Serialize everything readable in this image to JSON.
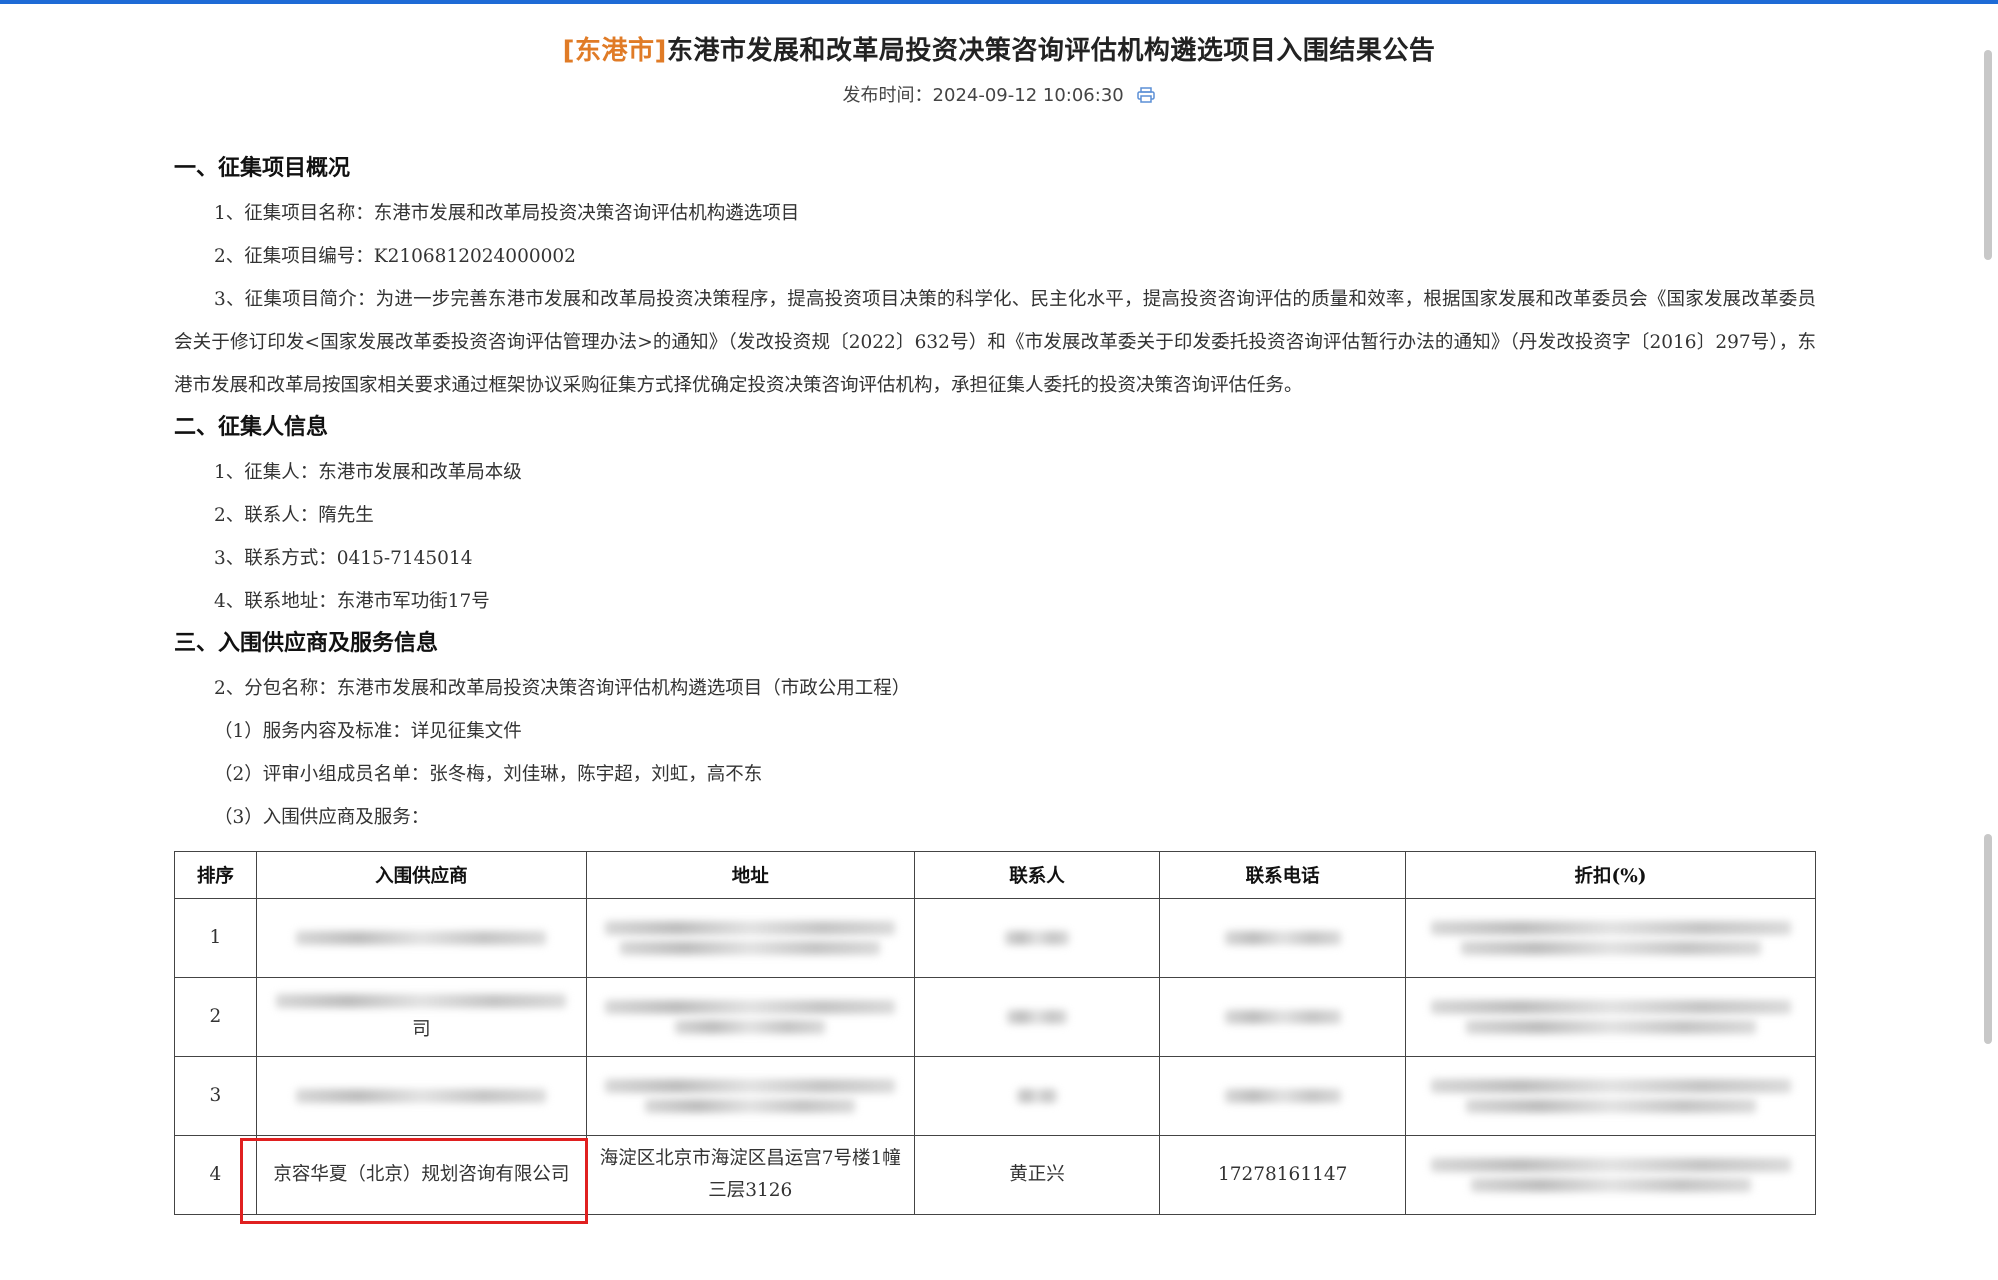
{
  "header": {
    "region_tag": "[东港市]",
    "title": "东港市发展和改革局投资决策咨询评估机构遴选项目入围结果公告",
    "publish_label": "发布时间：",
    "publish_time": "2024-09-12 10:06:30"
  },
  "section1": {
    "heading": "一、征集项目概况",
    "item1": "1、征集项目名称：东港市发展和改革局投资决策咨询评估机构遴选项目",
    "item2": "2、征集项目编号：K2106812024000002",
    "item3": "3、征集项目简介：为进一步完善东港市发展和改革局投资决策程序，提高投资项目决策的科学化、民主化水平，提高投资咨询评估的质量和效率，根据国家发展和改革委员会《国家发展改革委员会关于修订印发<国家发展改革委投资咨询评估管理办法>的通知》（发改投资规〔2022〕632号）和《市发展改革委关于印发委托投资咨询评估暂行办法的通知》（丹发改投资字〔2016〕297号），东港市发展和改革局按国家相关要求通过框架协议采购征集方式择优确定投资决策咨询评估机构，承担征集人委托的投资决策咨询评估任务。"
  },
  "section2": {
    "heading": "二、征集人信息",
    "item1": "1、征集人：东港市发展和改革局本级",
    "item2": "2、联系人：隋先生",
    "item3": "3、联系方式：0415-7145014",
    "item4": "4、联系地址：东港市军功街17号"
  },
  "section3": {
    "heading": "三、入围供应商及服务信息",
    "item1": "2、分包名称：东港市发展和改革局投资决策咨询评估机构遴选项目（市政公用工程）",
    "item2": "（1）服务内容及标准：详见征集文件",
    "item3": "（2）评审小组成员名单：张冬梅，刘佳琳，陈宇超，刘虹，高不东",
    "item4": "（3）入围供应商及服务："
  },
  "table": {
    "headers": [
      "排序",
      "入围供应商",
      "地址",
      "联系人",
      "联系电话",
      "折扣(%)"
    ],
    "rows": [
      {
        "rank": "1"
      },
      {
        "rank": "2",
        "supplier_tail": "司"
      },
      {
        "rank": "3"
      },
      {
        "rank": "4",
        "supplier": "京容华夏（北京）规划咨询有限公司",
        "address": "海淀区北京市海淀区昌运宫7号楼1幢三层3126",
        "contact": "黄正兴",
        "phone": "17278161147"
      }
    ]
  },
  "colors": {
    "accent_blue": "#1e6bd6",
    "region_orange": "#e07b26",
    "highlight_red": "#e02020"
  },
  "icons": {
    "print": "print-icon"
  }
}
